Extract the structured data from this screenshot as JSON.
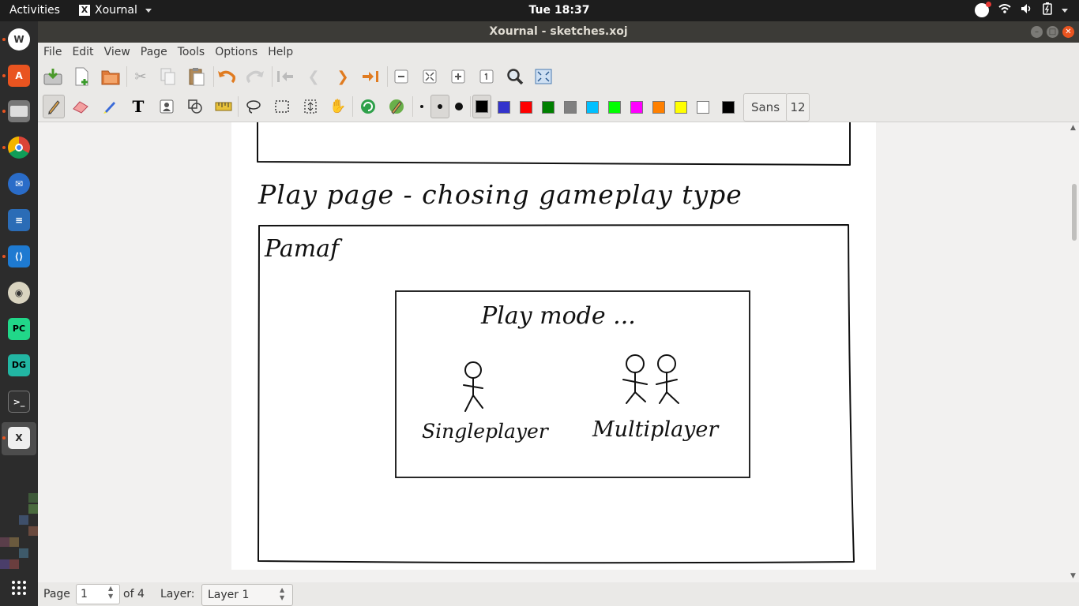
{
  "topbar": {
    "activities": "Activities",
    "app_name": "Xournal",
    "clock": "Tue 18:37"
  },
  "window": {
    "title": "Xournal - sketches.xoj"
  },
  "menu": [
    "File",
    "Edit",
    "View",
    "Page",
    "Tools",
    "Options",
    "Help"
  ],
  "toolbar": {
    "font_name": "Sans",
    "font_size": "12",
    "colors": [
      "#000000",
      "#3333cc",
      "#ff0000",
      "#008000",
      "#808080",
      "#00c0ff",
      "#00ff00",
      "#ff00ff",
      "#ff8000",
      "#ffff00",
      "#ffffff",
      "#000000"
    ]
  },
  "sketch": {
    "heading": "Play page - chosing gameplay type",
    "app_label": "Pamaf",
    "dialog_title": "Play mode ...",
    "option_single": "Singleplayer",
    "option_multi": "Multiplayer"
  },
  "status": {
    "page_label": "Page",
    "page_value": "1",
    "page_of": "of 4",
    "layer_label": "Layer:",
    "layer_value": "Layer 1"
  }
}
